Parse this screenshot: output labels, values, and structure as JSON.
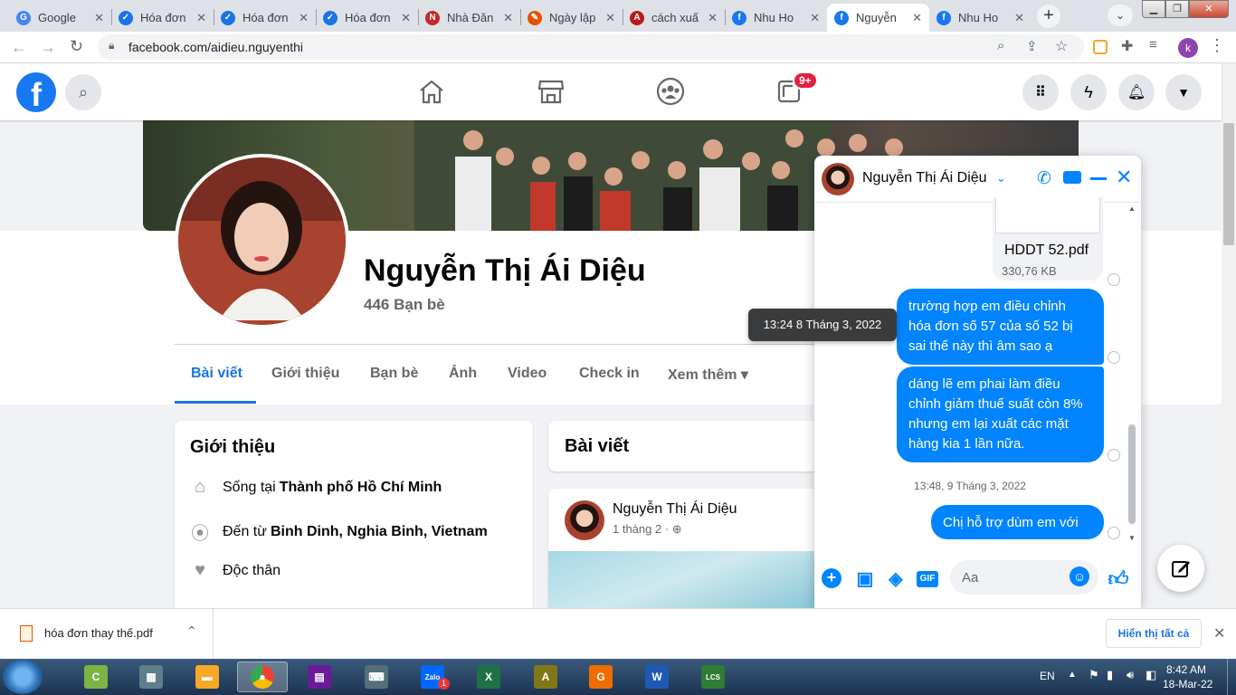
{
  "browser": {
    "tabs": [
      {
        "label": "Google",
        "color": "#4285f4",
        "glyph": "G"
      },
      {
        "label": "Hóa đơn",
        "color": "#1a73e8",
        "glyph": "✓"
      },
      {
        "label": "Hóa đơn",
        "color": "#1a73e8",
        "glyph": "✓"
      },
      {
        "label": "Hóa đơn",
        "color": "#1a73e8",
        "glyph": "✓"
      },
      {
        "label": "Nhà Đăn",
        "color": "#c62828",
        "glyph": "N"
      },
      {
        "label": "Ngày lập",
        "color": "#e65100",
        "glyph": "✎"
      },
      {
        "label": "cách xuấ",
        "color": "#b71c1c",
        "glyph": "A"
      },
      {
        "label": "Nhu Ho",
        "color": "#1877f2",
        "glyph": "f"
      },
      {
        "label": "Nguyễn",
        "color": "#1877f2",
        "glyph": "f"
      },
      {
        "label": "Nhu Ho",
        "color": "#1877f2",
        "glyph": "f"
      }
    ],
    "active_tab_index": 8,
    "new_tab_glyph": "+",
    "url": "facebook.com/aidieu.nguyenthi",
    "profile_initial": "k"
  },
  "fb": {
    "notification_badge": "9+",
    "brand_color": "#1877f2"
  },
  "profile": {
    "name": "Nguyễn Thị Ái Diệu",
    "friends": "446 Bạn bè",
    "tabs": [
      "Bài viết",
      "Giới thiệu",
      "Bạn bè",
      "Ảnh",
      "Video",
      "Check in",
      "Xem thêm ▾"
    ],
    "active_tab_index": 0
  },
  "intro": {
    "title": "Giới thiệu",
    "rows": [
      {
        "icon": "home-icon",
        "prefix": "Sống tại ",
        "bold": "Thành phố Hồ Chí Minh"
      },
      {
        "icon": "location-pin-icon",
        "prefix": "Đến từ ",
        "bold": "Binh Dinh, Nghia Binh, Vietnam"
      },
      {
        "icon": "heart-icon",
        "prefix": "Độc thân",
        "bold": ""
      }
    ]
  },
  "posts": {
    "title": "Bài viết",
    "post_author": "Nguyễn Thị Ái Diệu",
    "post_time": "1 tháng 2 ·"
  },
  "tooltip": "13:24 8 Tháng 3, 2022",
  "chat": {
    "contact_name": "Nguyễn Thị Ái Diệu",
    "attachment_name": "HDDT 52.pdf",
    "attachment_size": "330,76 KB",
    "messages": [
      "trường hợp em điều chỉnh hóa đơn số 57 của số 52 bị sai thế này thì âm sao ạ",
      "dáng lẽ em phai làm điều chỉnh giảm thuế suất còn 8% nhưng em lại xuất các mặt hàng kia 1 lần nữa.",
      "Chị hỗ trợ dùm em với"
    ],
    "timestamp": "13:48, 9 Tháng 3, 2022",
    "input_placeholder": "Aa",
    "gif_label": "GIF"
  },
  "download": {
    "filename": "hóa đơn thay thế.pdf",
    "show_all": "Hiển thị tất cả"
  },
  "taskbar": {
    "language": "EN",
    "time": "8:42 AM",
    "date": "18-Mar-22",
    "zalo_badge": "1",
    "apps": [
      {
        "name": "coccoc",
        "color": "#7cb342",
        "glyph": "C"
      },
      {
        "name": "calculator",
        "color": "#607d8b",
        "glyph": "▦"
      },
      {
        "name": "explorer",
        "color": "#f9a825",
        "glyph": "▬"
      },
      {
        "name": "chrome",
        "color": "#e53935",
        "glyph": "●"
      },
      {
        "name": "winrar",
        "color": "#6a1b9a",
        "glyph": "▤"
      },
      {
        "name": "keyboard",
        "color": "#546e7a",
        "glyph": "⌨"
      },
      {
        "name": "zalo",
        "color": "#0068ff",
        "glyph": "Zalo"
      },
      {
        "name": "excel",
        "color": "#1e7145",
        "glyph": "X"
      },
      {
        "name": "app-a",
        "color": "#827717",
        "glyph": "A"
      },
      {
        "name": "foxit",
        "color": "#ef6c00",
        "glyph": "G"
      },
      {
        "name": "word",
        "color": "#1e5ab5",
        "glyph": "W"
      },
      {
        "name": "lcs-ca",
        "color": "#2e7d32",
        "glyph": "LCS"
      }
    ]
  }
}
